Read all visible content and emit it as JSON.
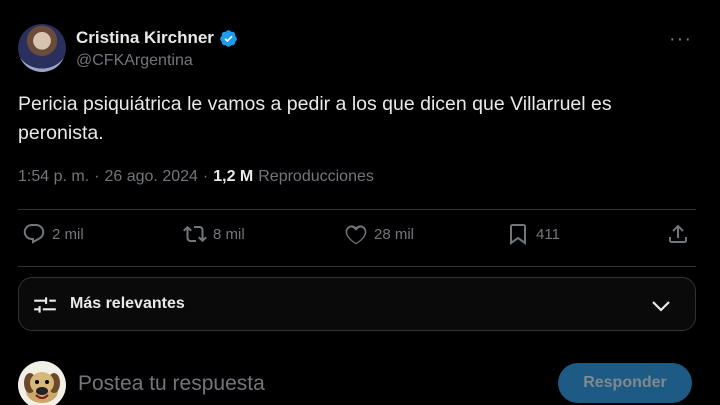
{
  "tweet": {
    "author": {
      "display_name": "Cristina Kirchner",
      "handle": "@CFKArgentina",
      "verified": true
    },
    "text_line1": "Pericia psiquiátrica le vamos a pedir a los que dicen que Villarruel es",
    "text_line2": "peronista.",
    "time": "1:54 p. m.",
    "separator": "·",
    "date": "26 ago. 2024",
    "views_count": "1,2 M",
    "views_label": "Reproducciones"
  },
  "actions": {
    "replies": "2 mil",
    "retweets": "8 mil",
    "likes": "28 mil",
    "bookmarks": "411"
  },
  "sort": {
    "label": "Más relevantes"
  },
  "reply": {
    "placeholder": "Postea tu respuesta",
    "button_label": "Responder"
  },
  "colors": {
    "background": "#000000",
    "text": "#e7e9ea",
    "secondary": "#71767b",
    "verified": "#1d9bf0",
    "reply_button": "#1d5a84"
  },
  "icons": [
    "more-icon",
    "verified-icon",
    "reply-icon",
    "retweet-icon",
    "like-icon",
    "bookmark-icon",
    "share-icon",
    "sort-icon",
    "chevron-down-icon"
  ]
}
